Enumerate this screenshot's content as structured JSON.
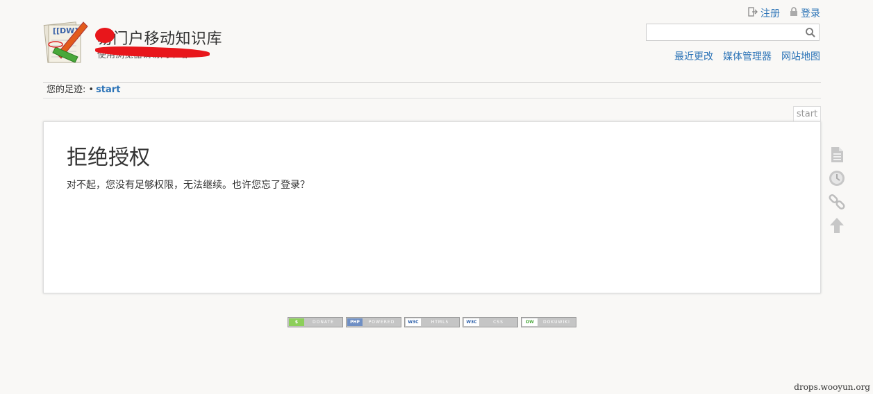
{
  "header": {
    "site_title": "易门户移动知识库",
    "tagline": "使用浏览器请访问本站",
    "logo_text": "[[DW]]"
  },
  "user_tools": {
    "register": "注册",
    "login": "登录"
  },
  "search": {
    "value": "",
    "placeholder": ""
  },
  "site_tools": {
    "recent_changes": "最近更改",
    "media_manager": "媒体管理器",
    "sitemap": "网站地图"
  },
  "breadcrumbs": {
    "label": "您的足迹:",
    "separator": "•",
    "current": "start"
  },
  "page": {
    "id": "start",
    "title": "拒绝授权",
    "message": "对不起，您没有足够权限，无法继续。也许您忘了登录？"
  },
  "badges": [
    {
      "tag": "$",
      "text": "DONATE",
      "color": "#8ccf5a"
    },
    {
      "tag": "PHP",
      "text": "POWERED",
      "color": "#6f8fc4"
    },
    {
      "tag": "W3C",
      "text": "HTML5",
      "color": "#ffffff"
    },
    {
      "tag": "W3C",
      "text": "CSS",
      "color": "#ffffff"
    },
    {
      "tag": "DW",
      "text": "DOKUWIKI",
      "color": "#ffffff"
    }
  ],
  "watermark": "drops.wooyun.org",
  "colors": {
    "link": "#2b73b7",
    "redaction": "#e8161b",
    "background": "#f9f8f6"
  }
}
